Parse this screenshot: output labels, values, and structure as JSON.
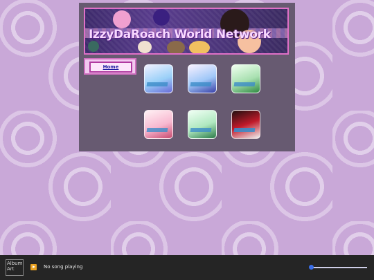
{
  "site": {
    "title": "IzzyDaRoach World Network"
  },
  "nav": {
    "home_label": "Home"
  },
  "gallery": {
    "items": [
      {
        "colors": [
          "#f0f0ff",
          "#6a6ad8",
          "#9ad0f8"
        ]
      },
      {
        "colors": [
          "#f8f0ff",
          "#3a40a8",
          "#a0c8f8"
        ]
      },
      {
        "colors": [
          "#f0fff0",
          "#2e8a40",
          "#a8e0b0"
        ]
      },
      {
        "colors": [
          "#fff0f4",
          "#c84a70",
          "#f8b8d0"
        ]
      },
      {
        "colors": [
          "#f0fff4",
          "#2a7a48",
          "#b0e8c0"
        ]
      },
      {
        "colors": [
          "#201010",
          "#c01a2a",
          "#f0f0f0"
        ]
      }
    ]
  },
  "player": {
    "album_art_alt": "Album Art",
    "status": "No song playing",
    "volume": 0.0
  }
}
